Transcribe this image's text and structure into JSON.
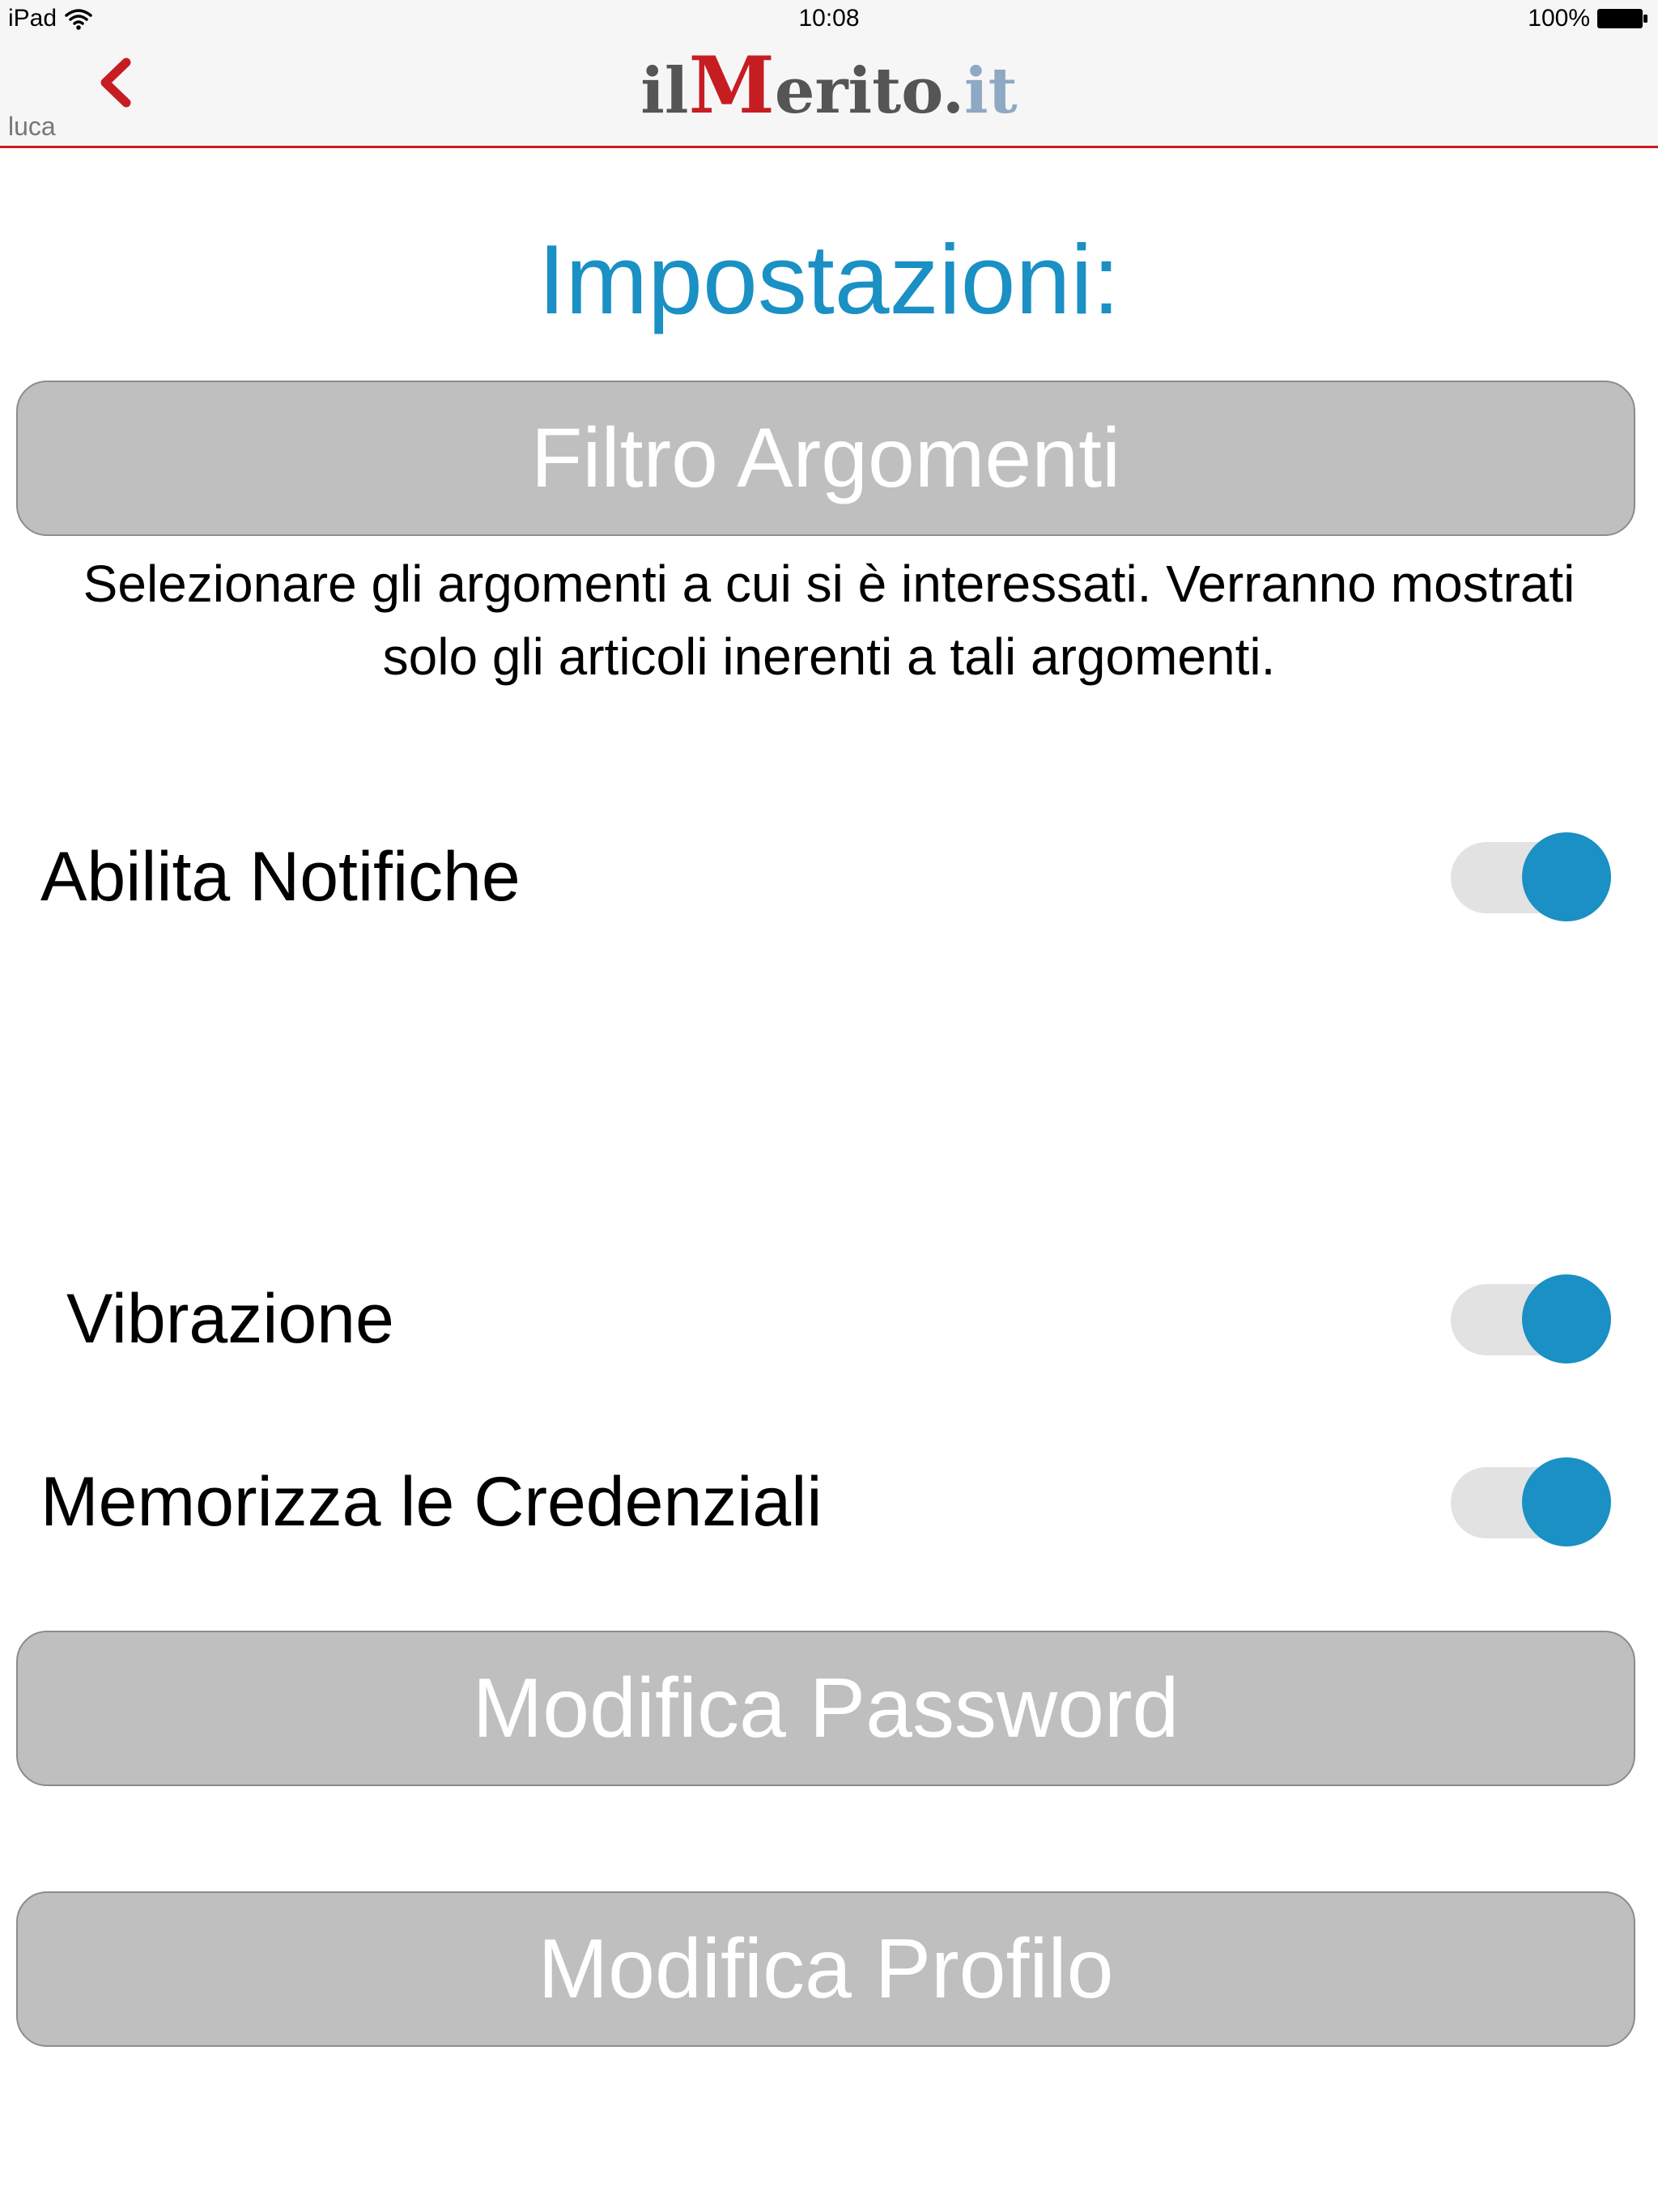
{
  "status_bar": {
    "device": "iPad",
    "time": "10:08",
    "battery": "100%"
  },
  "header": {
    "logo": {
      "prefix": "il",
      "initial": "M",
      "rest": "erito.",
      "suffix": "it"
    },
    "user": "luca"
  },
  "page": {
    "title": "Impostazioni:"
  },
  "buttons": {
    "filter_topics": "Filtro Argomenti",
    "change_password": "Modifica Password",
    "edit_profile": "Modifica Profilo"
  },
  "filter_description": "Selezionare gli argomenti a cui si è interessati. Verranno mostrati solo gli articoli inerenti a tali argomenti.",
  "settings": {
    "notifications": {
      "label": "Abilita Notifiche",
      "enabled": true
    },
    "vibration": {
      "label": "Vibrazione",
      "enabled": true
    },
    "remember_credentials": {
      "label": "Memorizza le Credenziali",
      "enabled": true
    }
  },
  "colors": {
    "accent": "#1a90c4",
    "brand_red": "#c61d23",
    "button_gray": "#bfbfbf"
  },
  "icons": {
    "back": "chevron-left-icon",
    "wifi": "wifi-icon",
    "battery": "battery-icon"
  }
}
